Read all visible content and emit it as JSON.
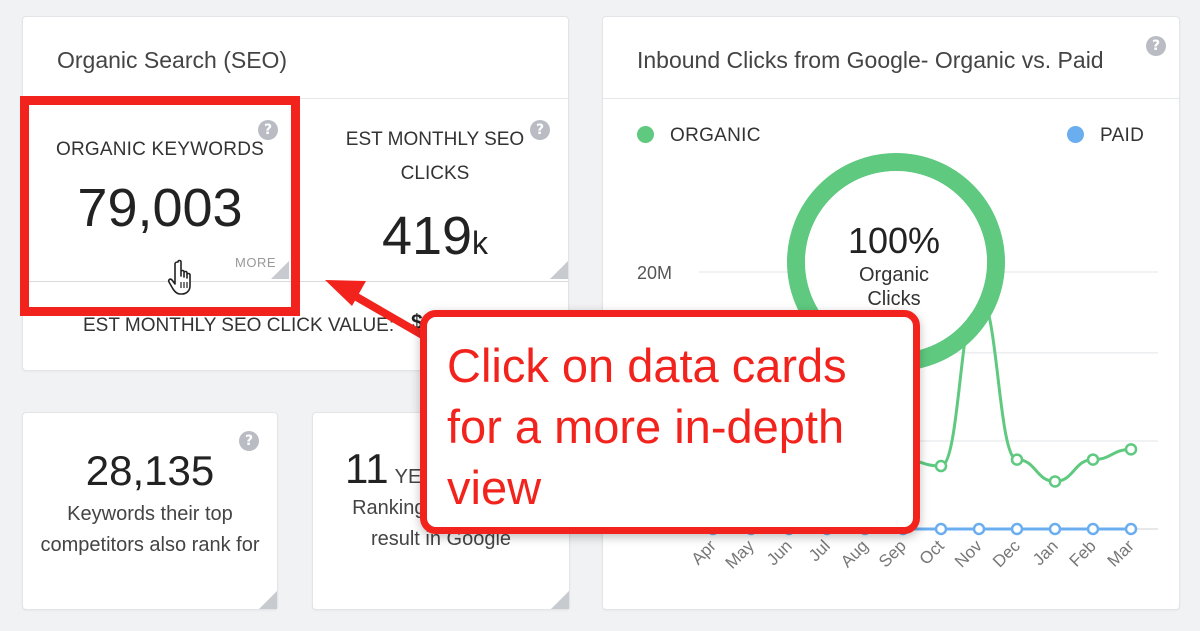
{
  "seo_card": {
    "title": "Organic Search (SEO)",
    "organic_keywords": {
      "label": "ORGANIC KEYWORDS",
      "value": "79,003",
      "more": "MORE"
    },
    "monthly_clicks": {
      "label": "EST MONTHLY SEO CLICKS",
      "value": "419",
      "unit": "k"
    },
    "click_value": {
      "label": "EST MONTHLY SEO CLICK VALUE:",
      "value": "$"
    }
  },
  "competitors_card": {
    "value": "28,135",
    "text": "Keywords their top competitors also rank for"
  },
  "years_card": {
    "value": "11",
    "unit": "YE",
    "text": "Ranking to their first result in Google"
  },
  "chart_card": {
    "title": "Inbound Clicks from Google- Organic vs. Paid",
    "legend": [
      {
        "label": "ORGANIC",
        "color": "#5ec97f"
      },
      {
        "label": "PAID",
        "color": "#6aaef0"
      }
    ],
    "donut": {
      "percent": "100%",
      "line1": "Organic",
      "line2": "Clicks",
      "organic_share": 1.0
    }
  },
  "chart_data": {
    "type": "line",
    "x": [
      "Apr",
      "May",
      "Jun",
      "Jul",
      "Aug",
      "Sep",
      "Oct",
      "Nov",
      "Dec",
      "Jan",
      "Feb",
      "Mar"
    ],
    "y_ticks": [
      "20M"
    ],
    "series": [
      {
        "name": "ORGANIC",
        "color": "#5ec97f",
        "values": [
          null,
          null,
          null,
          null,
          null,
          5.4,
          4.9,
          18.1,
          5.4,
          3.7,
          5.4,
          6.2
        ]
      },
      {
        "name": "PAID",
        "color": "#6aaef0",
        "values": [
          0,
          0,
          0,
          0,
          0,
          0,
          0,
          0,
          0,
          0,
          0,
          0
        ]
      }
    ],
    "ylim": [
      0,
      27
    ],
    "grid": true
  },
  "callout": {
    "text": "Click on data cards for a more in-depth view",
    "color": "#f2231d"
  },
  "icons": {
    "help": "?"
  }
}
